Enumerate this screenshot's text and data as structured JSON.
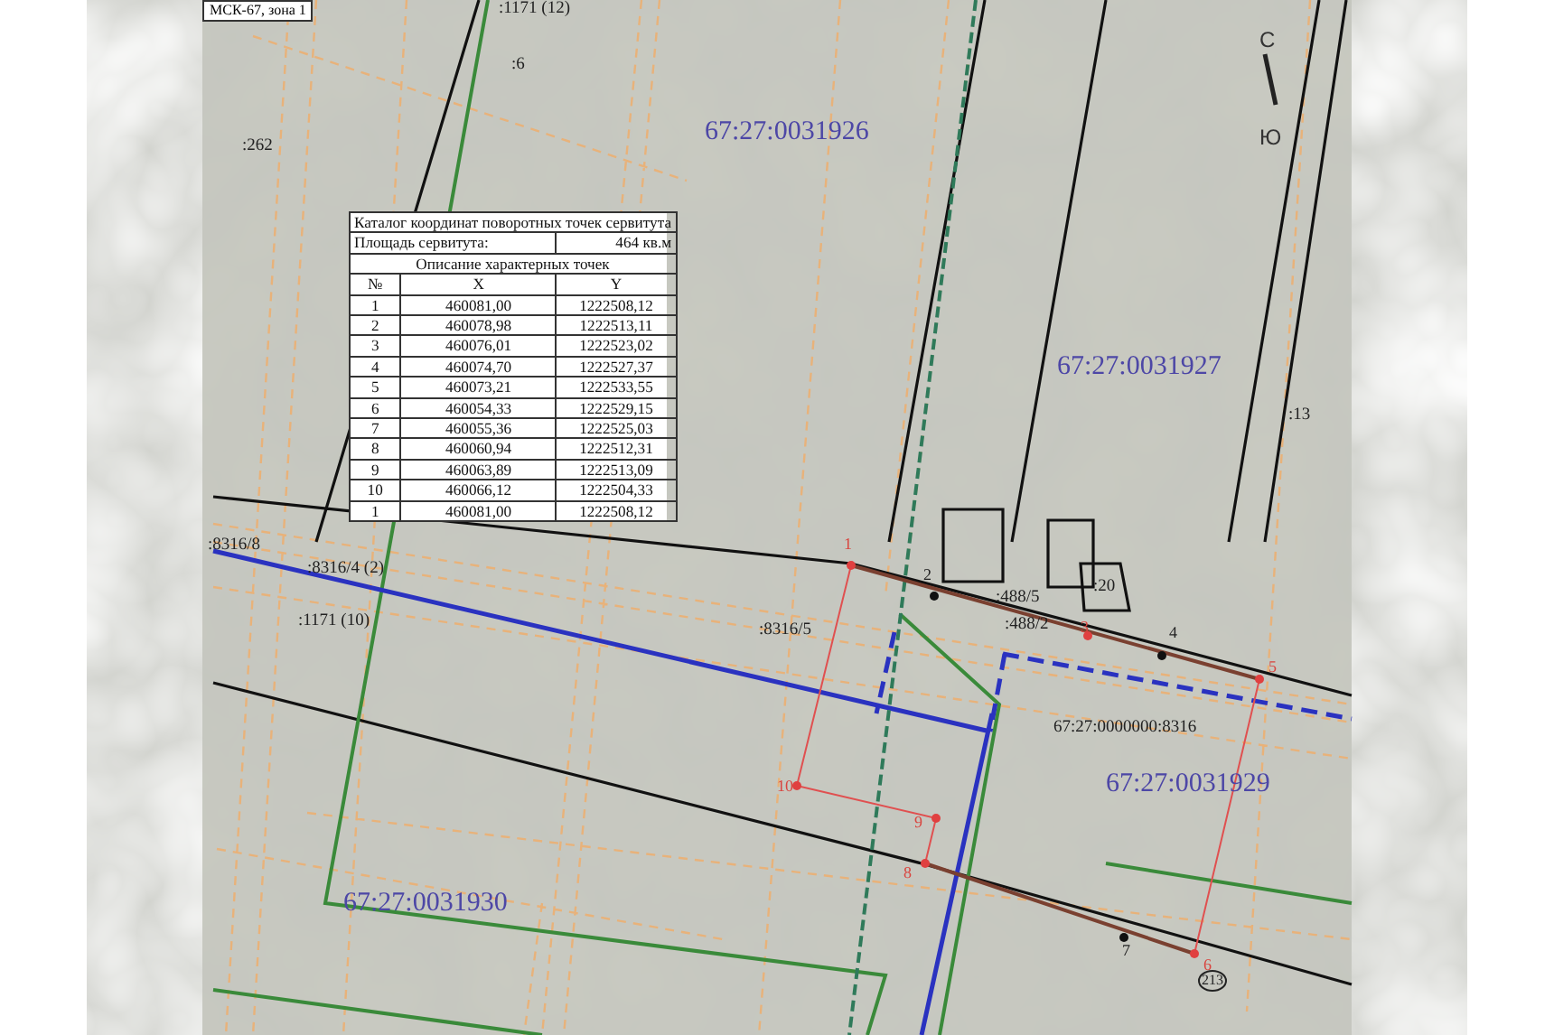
{
  "map": {
    "crs_label": "МСК-67, зона 1",
    "compass": {
      "north": "С",
      "south": "Ю"
    },
    "labels": [
      {
        "text": ":1171 (12)",
        "kind": "parcel"
      },
      {
        "text": ":6",
        "kind": "parcel"
      },
      {
        "text": ":262",
        "kind": "parcel"
      },
      {
        "text": "67:27:0031926",
        "kind": "block"
      },
      {
        "text": "67:27:0031927",
        "kind": "block"
      },
      {
        "text": ":13",
        "kind": "parcel"
      },
      {
        "text": ":8316/8",
        "kind": "parcel"
      },
      {
        "text": ":8316/4 (2)",
        "kind": "parcel"
      },
      {
        "text": ":1171 (10)",
        "kind": "parcel"
      },
      {
        "text": ":8316/5",
        "kind": "parcel"
      },
      {
        "text": ":20",
        "kind": "parcel"
      },
      {
        "text": ":488/5",
        "kind": "parcel"
      },
      {
        "text": ":488/2",
        "kind": "parcel"
      },
      {
        "text": "67:27:0000000:8316",
        "kind": "parcel"
      },
      {
        "text": "67:27:0031929",
        "kind": "block"
      },
      {
        "text": "67:27:0031930",
        "kind": "block"
      },
      {
        "text": "1",
        "kind": "vertex"
      },
      {
        "text": "2",
        "kind": "mark"
      },
      {
        "text": "3",
        "kind": "vertex"
      },
      {
        "text": "4",
        "kind": "mark"
      },
      {
        "text": "5",
        "kind": "vertex"
      },
      {
        "text": "6",
        "kind": "vertex"
      },
      {
        "text": "7",
        "kind": "mark"
      },
      {
        "text": "8",
        "kind": "vertex"
      },
      {
        "text": "9",
        "kind": "vertex"
      },
      {
        "text": "10",
        "kind": "vertex"
      },
      {
        "text": "213",
        "kind": "circled"
      }
    ]
  },
  "table": {
    "title": "Каталог координат поворотных точек сервитута",
    "area_label": "Площадь сервитута:",
    "area_value": "464 кв.м",
    "subtitle": "Описание характерных точек",
    "columns": [
      "№",
      "X",
      "Y"
    ],
    "rows": [
      [
        "1",
        "460081,00",
        "1222508,12"
      ],
      [
        "2",
        "460078,98",
        "1222513,11"
      ],
      [
        "3",
        "460076,01",
        "1222523,02"
      ],
      [
        "4",
        "460074,70",
        "1222527,37"
      ],
      [
        "5",
        "460073,21",
        "1222533,55"
      ],
      [
        "6",
        "460054,33",
        "1222529,15"
      ],
      [
        "7",
        "460055,36",
        "1222525,03"
      ],
      [
        "8",
        "460060,94",
        "1222512,31"
      ],
      [
        "9",
        "460063,89",
        "1222513,09"
      ],
      [
        "10",
        "460066,12",
        "1222504,33"
      ],
      [
        "1",
        "460081,00",
        "1222508,12"
      ]
    ]
  }
}
